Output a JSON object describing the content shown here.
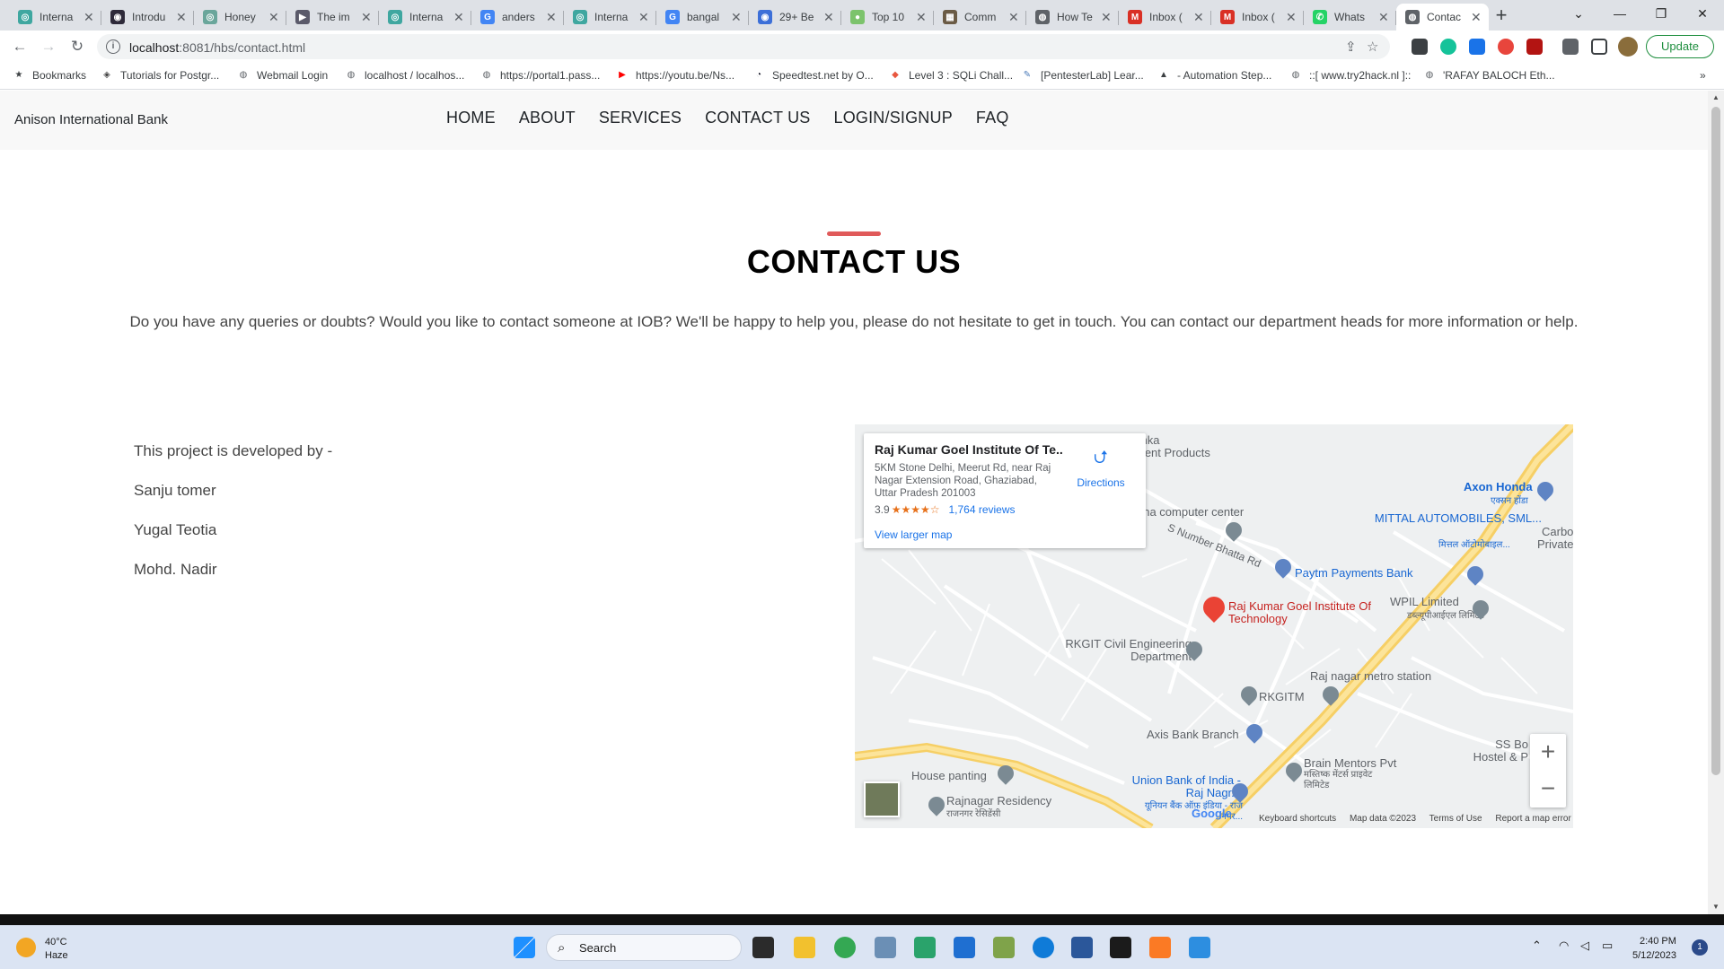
{
  "browser": {
    "tabs": [
      {
        "title": "Interna",
        "color": "#3fa7a0",
        "glyph": "◎"
      },
      {
        "title": "Introdu",
        "color": "#2e2a3a",
        "glyph": "◉"
      },
      {
        "title": "Honey",
        "color": "#6aa69b",
        "glyph": "◎"
      },
      {
        "title": "The im",
        "color": "#5a5a6a",
        "glyph": "▶"
      },
      {
        "title": "Interna",
        "color": "#3fa7a0",
        "glyph": "◎"
      },
      {
        "title": "anders",
        "color": "#4285f4",
        "glyph": "G"
      },
      {
        "title": "Interna",
        "color": "#3fa7a0",
        "glyph": "◎"
      },
      {
        "title": "bangal",
        "color": "#4285f4",
        "glyph": "G"
      },
      {
        "title": "29+ Be",
        "color": "#3c6fd8",
        "glyph": "◉"
      },
      {
        "title": "Top 10",
        "color": "#7cc36c",
        "glyph": "●"
      },
      {
        "title": "Comm",
        "color": "#6b5b45",
        "glyph": "▦"
      },
      {
        "title": "How Te",
        "color": "#5f6368",
        "glyph": "◍"
      },
      {
        "title": "Inbox (",
        "color": "#d93025",
        "glyph": "M"
      },
      {
        "title": "Inbox (",
        "color": "#d93025",
        "glyph": "M"
      },
      {
        "title": "Whats",
        "color": "#25d366",
        "glyph": "✆"
      },
      {
        "title": "Contac",
        "color": "#5f6368",
        "glyph": "◍",
        "active": true
      }
    ],
    "url_host": "localhost",
    "url_rest": ":8081/hbs/contact.html",
    "update_label": "Update",
    "bookmarks": [
      {
        "label": "Bookmarks",
        "icon": "star-icon",
        "glyph": "★",
        "color": "#3c4043"
      },
      {
        "label": "Tutorials for Postgr...",
        "icon": "diamond-icon",
        "glyph": "◈",
        "color": "#444"
      },
      {
        "label": "Webmail Login",
        "icon": "globe-icon",
        "glyph": "◍",
        "color": "#5f6368"
      },
      {
        "label": "localhost / localhos...",
        "icon": "globe-icon",
        "glyph": "◍",
        "color": "#5f6368"
      },
      {
        "label": "https://portal1.pass...",
        "icon": "globe-icon",
        "glyph": "◍",
        "color": "#5f6368"
      },
      {
        "label": "https://youtu.be/Ns...",
        "icon": "youtube-icon",
        "glyph": "▶",
        "color": "#ff0000"
      },
      {
        "label": "Speedtest.net by O...",
        "icon": "speedtest-icon",
        "glyph": "◔",
        "color": "#141526"
      },
      {
        "label": "Level 3 : SQLi Chall...",
        "icon": "flag-icon",
        "glyph": "◆",
        "color": "#e8573f"
      },
      {
        "label": "[PentesterLab] Lear...",
        "icon": "pen-icon",
        "glyph": "✎",
        "color": "#4a7ab8"
      },
      {
        "label": "- Automation Step...",
        "icon": "flask-icon",
        "glyph": "▲",
        "color": "#3c4043"
      },
      {
        "label": "::[ www.try2hack.nl ]::",
        "icon": "globe-icon",
        "glyph": "◍",
        "color": "#5f6368"
      },
      {
        "label": "'RAFAY BALOCH Eth...",
        "icon": "globe-icon",
        "glyph": "◍",
        "color": "#5f6368"
      }
    ]
  },
  "site": {
    "brand": "Anison International Bank",
    "nav": [
      "HOME",
      "ABOUT",
      "SERVICES",
      "CONTACT US",
      "LOGIN/SIGNUP",
      "FAQ"
    ],
    "title": "CONTACT US",
    "intro": "Do you have any queries or doubts? Would you like to contact someone at IOB? We'll be happy to help you, please do not hesitate to get in touch. You can contact our department heads for more information or help.",
    "developers_heading": "This project is developed by -",
    "developers": [
      "Sanju tomer",
      "Yugal Teotia",
      "Mohd. Nadir"
    ],
    "accent_color": "#e05a5a"
  },
  "map": {
    "place_name": "Raj Kumar Goel Institute Of Te...",
    "place_address": "5KM Stone Delhi, Meerut Rd, near Raj Nagar Extension Road, Ghaziabad, Uttar Pradesh 201003",
    "rating": "3.9",
    "stars": "★★★★☆",
    "reviews": "1,764 reviews",
    "directions": "Directions",
    "view_larger": "View larger map",
    "labels": {
      "rkgit": "Raj Kumar Goel Institute Of Technology",
      "paytm": "Paytm Payments Bank",
      "axon": "Axon Honda",
      "axon_hi": "एक्सन होंडा",
      "mittal": "MITTAL AUTOMOBILES, SML...",
      "mittal_hi": "मित्तल ऑटोमोबाइल...",
      "wpil": "WPIL Limited",
      "wpil_hi": "डब्ल्यूपीआईएल लिमिटेड",
      "rkgit_civil": "RKGIT Civil Engineering Department",
      "rajnagar_metro": "Raj nagar metro station",
      "rkgitm": "RKGITM",
      "axis": "Axis Bank Branch",
      "brain": "Brain Mentors Pvt",
      "brain_hi": "मस्तिष्क मेंटर्स प्राइवेट लिमिटेड",
      "union": "Union Bank of India - Raj Nagr...",
      "union_hi": "यूनियन बैंक ऑफ़ इंडिया - राज नगर...",
      "house": "House panting",
      "rajnagar_res": "Rajnagar Residency",
      "rajnagar_res_hi": "राजनगर रेसिडेंसी",
      "computer": "nna computer center",
      "road": "S Number Bhatta Rd",
      "shka": "shka",
      "ment": "ment Products",
      "carbo": "Carbo",
      "private": "Private",
      "ssbo": "SS Bo",
      "hostel": "Hostel & P"
    },
    "footer": [
      "Keyboard shortcuts",
      "Map data ©2023",
      "Terms of Use",
      "Report a map error"
    ],
    "google": "Google"
  },
  "taskbar": {
    "temperature": "40°C",
    "condition": "Haze",
    "search_label": "Search",
    "time": "2:40 PM",
    "date": "5/12/2023",
    "notification_count": "1"
  }
}
